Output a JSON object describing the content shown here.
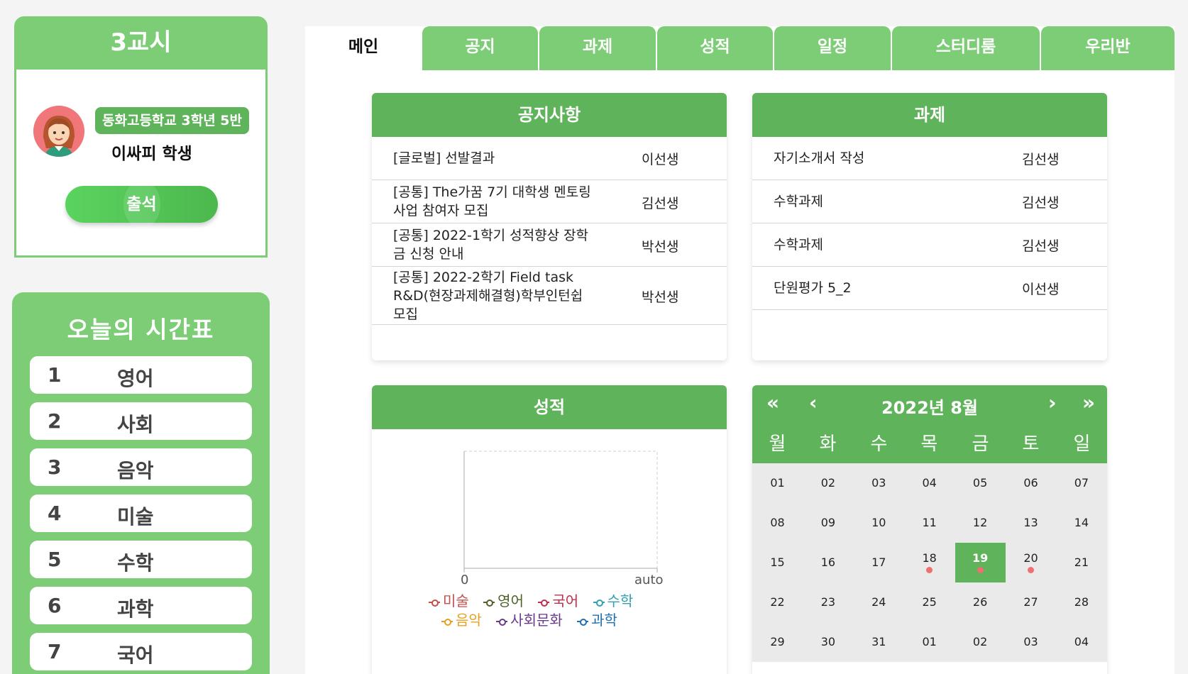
{
  "period": {
    "title": "3교시"
  },
  "profile": {
    "school": "동화고등학교 3학년 5반",
    "name": "이싸피 학생"
  },
  "attend_button": "출석",
  "timetable": {
    "title": "오늘의 시간표",
    "items": [
      {
        "num": "1",
        "subject": "영어"
      },
      {
        "num": "2",
        "subject": "사회"
      },
      {
        "num": "3",
        "subject": "음악"
      },
      {
        "num": "4",
        "subject": "미술"
      },
      {
        "num": "5",
        "subject": "수학"
      },
      {
        "num": "6",
        "subject": "과학"
      },
      {
        "num": "7",
        "subject": "국어"
      }
    ]
  },
  "tabs": [
    "메인",
    "공지",
    "과제",
    "성적",
    "일정",
    "스터디룸",
    "우리반"
  ],
  "notice": {
    "title": "공지사항",
    "rows": [
      {
        "title": "[글로벌] 선발결과",
        "writer": "이선생"
      },
      {
        "title": "[공통] The가꿈 7기 대학생 멘토링 사업 참여자 모집",
        "writer": "김선생"
      },
      {
        "title": "[공통] 2022-1학기 성적향상 장학금 신청 안내",
        "writer": "박선생"
      },
      {
        "title": "[공통] 2022-2학기 Field task R&D(현장과제해결형)학부인턴쉽 모집",
        "writer": "박선생"
      }
    ]
  },
  "homework": {
    "title": "과제",
    "rows": [
      {
        "title": "자기소개서 작성",
        "writer": "김선생"
      },
      {
        "title": "수학과제",
        "writer": "김선생"
      },
      {
        "title": "수학과제",
        "writer": "김선생"
      },
      {
        "title": "단원평가 5_2",
        "writer": "이선생"
      }
    ]
  },
  "grades": {
    "title": "성적",
    "chart_data": {
      "type": "line",
      "x_tick_labels": [
        "0",
        "auto"
      ],
      "series": [
        {
          "name": "미술",
          "color": "#c0504d",
          "values": []
        },
        {
          "name": "영어",
          "color": "#4f6228",
          "values": []
        },
        {
          "name": "국어",
          "color": "#c0304d",
          "values": []
        },
        {
          "name": "수학",
          "color": "#31a0b0",
          "values": []
        },
        {
          "name": "음악",
          "color": "#e6a020",
          "values": []
        },
        {
          "name": "사회문화",
          "color": "#6a3a8a",
          "values": []
        },
        {
          "name": "과학",
          "color": "#1f6fb0",
          "values": []
        }
      ]
    }
  },
  "calendar": {
    "title": "2022년 8월",
    "nav": {
      "prev_year": "«",
      "prev_month": "‹",
      "next_month": "›",
      "next_year": "»"
    },
    "weekdays": [
      "월",
      "화",
      "수",
      "목",
      "금",
      "토",
      "일"
    ],
    "days": [
      "01",
      "02",
      "03",
      "04",
      "05",
      "06",
      "07",
      "08",
      "09",
      "10",
      "11",
      "12",
      "13",
      "14",
      "15",
      "16",
      "17",
      "18",
      "19",
      "20",
      "21",
      "22",
      "23",
      "24",
      "25",
      "26",
      "27",
      "28",
      "29",
      "30",
      "31",
      "01",
      "02",
      "03",
      "04"
    ],
    "today": "19",
    "event_days": [
      "18",
      "19",
      "20"
    ],
    "colors": {
      "accent": "#5fb35a",
      "event_dot": "#f0706f"
    }
  },
  "colors": {
    "primary": "#7ccd76",
    "dark": "#5fb35a"
  }
}
